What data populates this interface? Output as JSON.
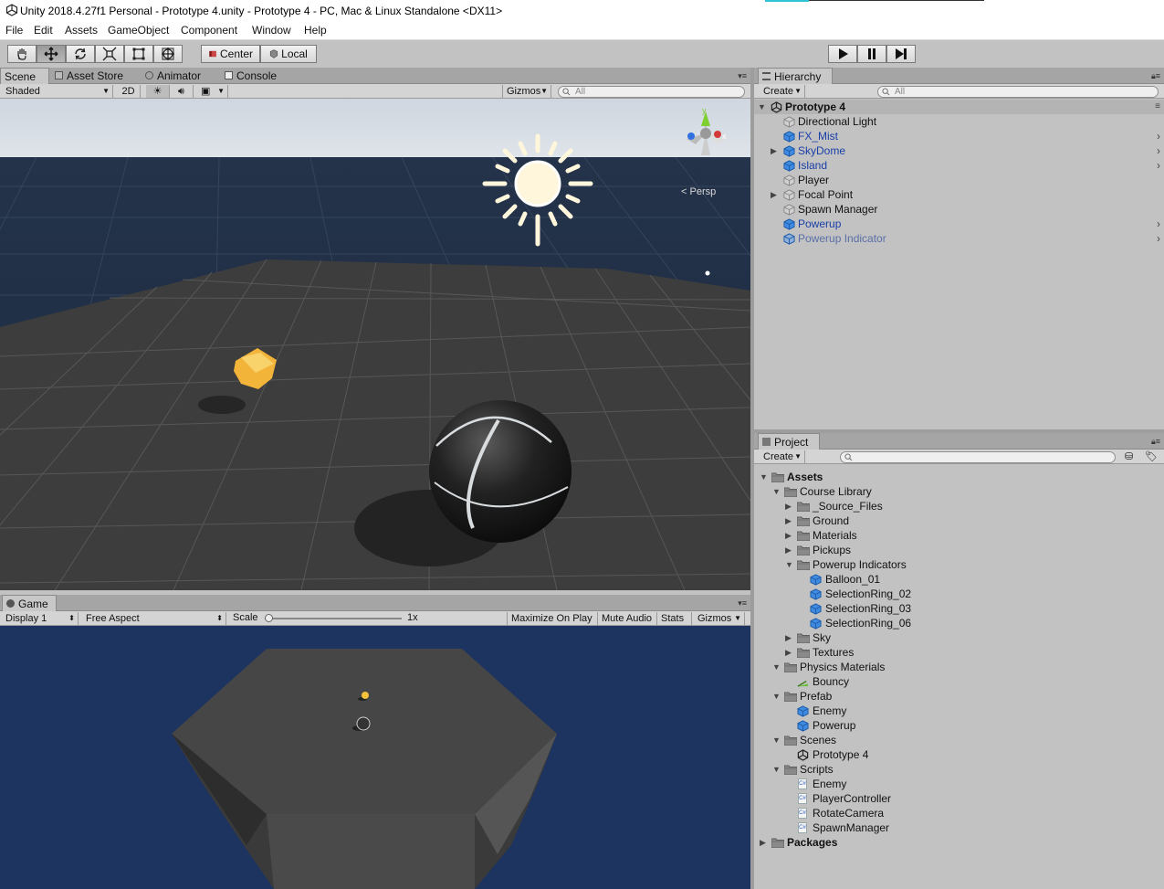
{
  "window": {
    "title": "Unity 2018.4.27f1 Personal - Prototype 4.unity - Prototype 4 - PC, Mac & Linux Standalone <DX11>"
  },
  "menu": [
    "File",
    "Edit",
    "Assets",
    "GameObject",
    "Component",
    "Window",
    "Help"
  ],
  "toolbar": {
    "pivot_label": "Center",
    "space_label": "Local"
  },
  "scene_tabs": {
    "scene": "Scene",
    "asset_store": "Asset Store",
    "animator": "Animator",
    "console": "Console"
  },
  "scene_bar": {
    "shading": "Shaded",
    "mode_2d": "2D",
    "gizmos": "Gizmos",
    "search_placeholder": "All"
  },
  "scene_gizmo": {
    "y_label": "y",
    "x_label": "x",
    "projection": "Persp"
  },
  "game_tab": {
    "label": "Game"
  },
  "game_bar": {
    "display": "Display 1",
    "aspect": "Free Aspect",
    "scale_label": "Scale",
    "scale_value": "1x",
    "maximize": "Maximize On Play",
    "mute": "Mute Audio",
    "stats": "Stats",
    "gizmos": "Gizmos",
    "scale_fraction": 0.0
  },
  "hierarchy": {
    "tab": "Hierarchy",
    "create": "Create",
    "search_placeholder": "All",
    "scene": "Prototype 4",
    "items": [
      {
        "label": "Directional Light",
        "kind": "plain",
        "foldout": false,
        "more": false
      },
      {
        "label": "FX_Mist",
        "kind": "prefab",
        "foldout": false,
        "more": true
      },
      {
        "label": "SkyDome",
        "kind": "prefab",
        "foldout": true,
        "more": true
      },
      {
        "label": "Island",
        "kind": "prefab",
        "foldout": false,
        "more": true
      },
      {
        "label": "Player",
        "kind": "plain",
        "foldout": false,
        "more": false
      },
      {
        "label": "Focal Point",
        "kind": "plain",
        "foldout": true,
        "more": false
      },
      {
        "label": "Spawn Manager",
        "kind": "plain",
        "foldout": false,
        "more": false
      },
      {
        "label": "Powerup",
        "kind": "prefab",
        "foldout": false,
        "more": true
      },
      {
        "label": "Powerup Indicator",
        "kind": "prefab-inactive",
        "foldout": false,
        "more": true
      }
    ]
  },
  "project": {
    "tab": "Project",
    "create": "Create",
    "tree": [
      {
        "label": "Assets",
        "depth": 0,
        "icon": "folder",
        "fold": "open",
        "bold": true
      },
      {
        "label": "Course Library",
        "depth": 1,
        "icon": "folder",
        "fold": "open"
      },
      {
        "label": "_Source_Files",
        "depth": 2,
        "icon": "folder",
        "fold": "closed"
      },
      {
        "label": "Ground",
        "depth": 2,
        "icon": "folder",
        "fold": "closed"
      },
      {
        "label": "Materials",
        "depth": 2,
        "icon": "folder",
        "fold": "closed"
      },
      {
        "label": "Pickups",
        "depth": 2,
        "icon": "folder",
        "fold": "closed"
      },
      {
        "label": "Powerup Indicators",
        "depth": 2,
        "icon": "folder",
        "fold": "open"
      },
      {
        "label": "Balloon_01",
        "depth": 3,
        "icon": "prefab",
        "fold": "none"
      },
      {
        "label": "SelectionRing_02",
        "depth": 3,
        "icon": "prefab",
        "fold": "none"
      },
      {
        "label": "SelectionRing_03",
        "depth": 3,
        "icon": "prefab",
        "fold": "none"
      },
      {
        "label": "SelectionRing_06",
        "depth": 3,
        "icon": "prefab",
        "fold": "none"
      },
      {
        "label": "Sky",
        "depth": 2,
        "icon": "folder",
        "fold": "closed"
      },
      {
        "label": "Textures",
        "depth": 2,
        "icon": "folder",
        "fold": "closed"
      },
      {
        "label": "Physics Materials",
        "depth": 1,
        "icon": "folder",
        "fold": "open"
      },
      {
        "label": "Bouncy",
        "depth": 2,
        "icon": "physics-material",
        "fold": "none"
      },
      {
        "label": "Prefab",
        "depth": 1,
        "icon": "folder",
        "fold": "open"
      },
      {
        "label": "Enemy",
        "depth": 2,
        "icon": "prefab",
        "fold": "none"
      },
      {
        "label": "Powerup",
        "depth": 2,
        "icon": "prefab",
        "fold": "none"
      },
      {
        "label": "Scenes",
        "depth": 1,
        "icon": "folder",
        "fold": "open"
      },
      {
        "label": "Prototype 4",
        "depth": 2,
        "icon": "unity-scene",
        "fold": "none"
      },
      {
        "label": "Scripts",
        "depth": 1,
        "icon": "folder",
        "fold": "open"
      },
      {
        "label": "Enemy",
        "depth": 2,
        "icon": "csharp",
        "fold": "none"
      },
      {
        "label": "PlayerController",
        "depth": 2,
        "icon": "csharp",
        "fold": "none"
      },
      {
        "label": "RotateCamera",
        "depth": 2,
        "icon": "csharp",
        "fold": "none"
      },
      {
        "label": "SpawnManager",
        "depth": 2,
        "icon": "csharp",
        "fold": "none"
      },
      {
        "label": "Packages",
        "depth": 0,
        "icon": "folder",
        "fold": "closed",
        "bold": true
      }
    ]
  },
  "colors": {
    "prefab_blue": "#1a3ea8",
    "sky": "#1c3460",
    "ground": "#3c3c3c",
    "accent": "#2ec4d6"
  }
}
